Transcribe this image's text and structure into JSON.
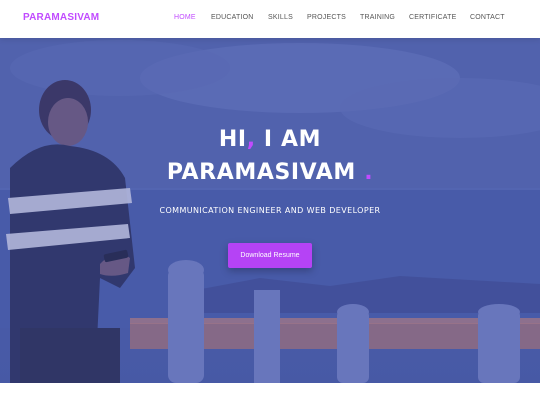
{
  "brand": {
    "name": "PARAMASIVAM",
    "color": "#c14bff"
  },
  "nav": {
    "items": [
      {
        "label": "HOME",
        "active": true
      },
      {
        "label": "EDUCATION",
        "active": false
      },
      {
        "label": "SKILLS",
        "active": false
      },
      {
        "label": "PROJECTS",
        "active": false
      },
      {
        "label": "TRAINING",
        "active": false
      },
      {
        "label": "CERTIFICATE",
        "active": false
      },
      {
        "label": "CONTACT",
        "active": false
      }
    ],
    "active_color": "#c14bff",
    "inactive_color": "#555555"
  },
  "hero": {
    "greeting_prefix": "HI",
    "greeting_comma": ",",
    "greeting_suffix": " I AM",
    "name": "PARAMASIVAM",
    "name_dot": ".",
    "subtitle": "COMMUNICATION ENGINEER AND WEB DEVELOPER",
    "button_label": "Download Resume",
    "accent_color": "#c14bff"
  }
}
